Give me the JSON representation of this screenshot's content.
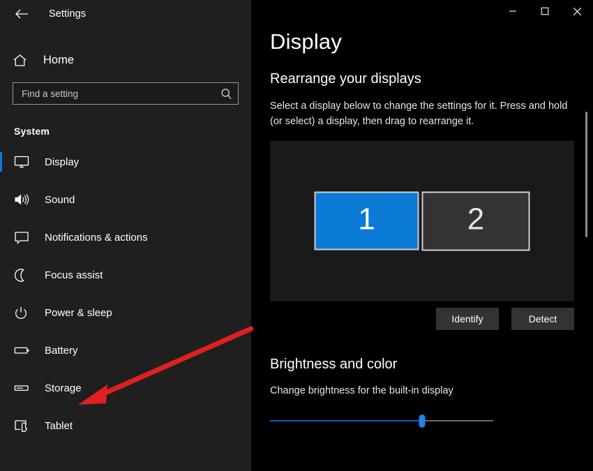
{
  "window": {
    "app_title": "Settings",
    "back_icon": "back-arrow-icon",
    "controls": {
      "minimize": "─",
      "maximize": "□",
      "close": "✕"
    }
  },
  "sidebar": {
    "home_label": "Home",
    "home_icon": "home-icon",
    "search": {
      "placeholder": "Find a setting",
      "value": "",
      "icon": "search-icon"
    },
    "section_heading": "System",
    "items": [
      {
        "label": "Display",
        "icon": "monitor-icon",
        "selected": true
      },
      {
        "label": "Sound",
        "icon": "speaker-icon",
        "selected": false
      },
      {
        "label": "Notifications & actions",
        "icon": "chat-bubble-icon",
        "selected": false
      },
      {
        "label": "Focus assist",
        "icon": "moon-icon",
        "selected": false
      },
      {
        "label": "Power & sleep",
        "icon": "power-icon",
        "selected": false
      },
      {
        "label": "Battery",
        "icon": "battery-icon",
        "selected": false
      },
      {
        "label": "Storage",
        "icon": "drive-icon",
        "selected": false
      },
      {
        "label": "Tablet",
        "icon": "tablet-icon",
        "selected": false
      }
    ]
  },
  "main": {
    "page_title": "Display",
    "rearrange": {
      "heading": "Rearrange your displays",
      "description": "Select a display below to change the settings for it. Press and hold (or select) a display, then drag to rearrange it.",
      "displays": [
        {
          "number": "1",
          "selected": true
        },
        {
          "number": "2",
          "selected": false
        }
      ],
      "identify_button": "Identify",
      "detect_button": "Detect"
    },
    "brightness": {
      "heading": "Brightness and color",
      "slider_label": "Change brightness for the built-in display",
      "slider_value": 68
    }
  },
  "colors": {
    "accent": "#0a7ad6",
    "sidebar_bg": "#1f1f1f",
    "content_bg": "#000000",
    "panel_bg": "#1a1a1a",
    "annotation": "#e02020"
  },
  "annotation": {
    "type": "arrow",
    "points_to": "Storage"
  }
}
